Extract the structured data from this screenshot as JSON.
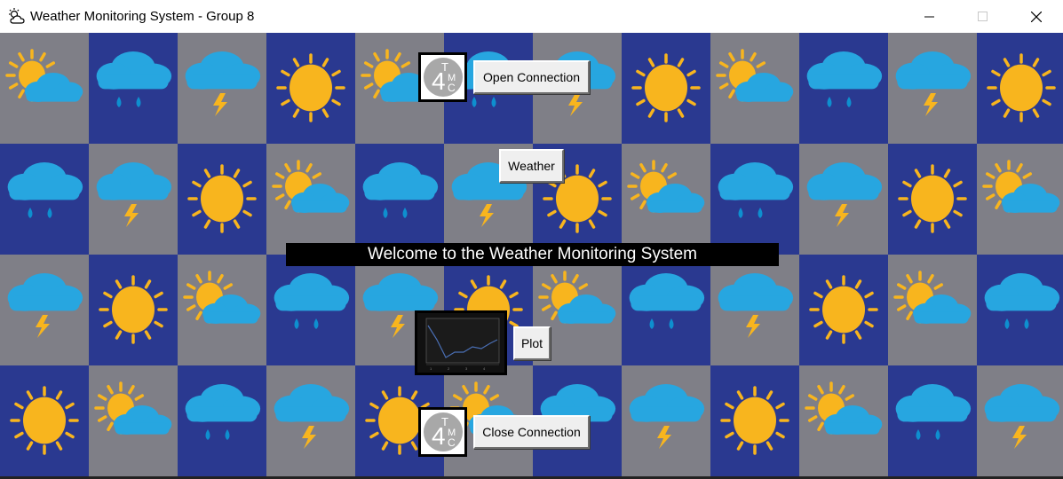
{
  "window": {
    "title": "Weather Monitoring System - Group 8",
    "icon": "partly-cloudy-icon",
    "controls": [
      "minimize-icon",
      "maximize-icon",
      "close-icon"
    ]
  },
  "buttons": {
    "open_connection": "Open Connection",
    "weather": "Weather",
    "plot": "Plot",
    "close_connection": "Close Connection"
  },
  "banner": {
    "text": "Welcome to the Weather Monitoring System"
  },
  "logo": {
    "letters": "4TMC"
  },
  "background": {
    "tile_icons": [
      "sun-icon",
      "sun-cloud-icon",
      "rain-cloud-icon",
      "storm-cloud-icon"
    ],
    "colors": {
      "blue_tile": "#2a3990",
      "gray_tile": "#7f7f87",
      "sun": "#f8b51e",
      "cloud": "#27a6e0",
      "rain": "#0e8fcf"
    }
  }
}
